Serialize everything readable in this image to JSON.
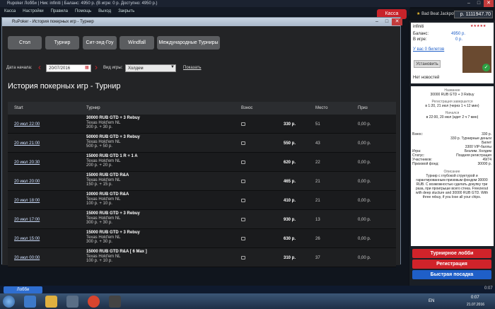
{
  "lobby": {
    "title": "Rupoker Лобби | Ник: infiniti | Баланс: 4950 р. (В игре: 0 р. Доступно: 4950 р.)",
    "menu": [
      "Касса",
      "Настройки",
      "Правила",
      "Помощь",
      "Выход",
      "Закрыть"
    ],
    "kassa_label": "Касса",
    "lobby_button": "Лобби"
  },
  "history": {
    "window_title": "RuPoker - История покерных игр - Турнир",
    "tabs": [
      "Стол",
      "Турнир",
      "Сит-энд-Гоу",
      "Windfall",
      "Международные Турниры"
    ],
    "date_label": "Дата начала:",
    "date_value": "20/07/2016",
    "game_label": "Вид игры:",
    "game_value": "Холдем",
    "show_label": "Показать",
    "page_title": "История покерных игр - Турнир",
    "columns": [
      "Start",
      "Турнир",
      "Взнос",
      "Место",
      "Приз"
    ],
    "rows": [
      {
        "date": "20 июл 22:00",
        "name": "30000 RUB GTD + 3 Rebuy",
        "game": "Texas Hold'em NL",
        "fee": "300 р. + 30 р.",
        "buyin": "330 р.",
        "place": "51",
        "prize": "0,00 р."
      },
      {
        "date": "20 июл 21:00",
        "name": "50000 RUB GTD + 3 Rebuy",
        "game": "Texas Hold'em NL",
        "fee": "500 р. + 50 р.",
        "buyin": "550 р.",
        "place": "43",
        "prize": "0,00 р."
      },
      {
        "date": "20 июл 20:30",
        "name": "15000 RUB GTD 1 R + 1 A",
        "game": "Texas Hold'em NL",
        "fee": "200 р. + 20 р.",
        "buyin": "620 р.",
        "place": "22",
        "prize": "0,00 р."
      },
      {
        "date": "20 июл 20:00",
        "name": "15000 RUB GTD R&A",
        "game": "Texas Hold'em NL",
        "fee": "150 р. + 15 р.",
        "buyin": "465 р.",
        "place": "21",
        "prize": "0,00 р."
      },
      {
        "date": "20 июл 18:00",
        "name": "10000 RUB GTD R&A",
        "game": "Texas Hold'em NL",
        "fee": "100 р. + 10 р.",
        "buyin": "410 р.",
        "place": "21",
        "prize": "0,00 р."
      },
      {
        "date": "20 июл 17:00",
        "name": "15000 RUB GTD + 3 Rebuy",
        "game": "Texas Hold'em NL",
        "fee": "300 р. + 30 р.",
        "buyin": "930 р.",
        "place": "13",
        "prize": "0,00 р."
      },
      {
        "date": "20 июл 15:00",
        "name": "15000 RUB GTD + 3 Rebuy",
        "game": "Texas Hold'em NL",
        "fee": "300 р. + 30 р.",
        "buyin": "630 р.",
        "place": "26",
        "prize": "0,00 р."
      },
      {
        "date": "20 июл 00:00",
        "name": "15000 RUB GTD R&A [ 6 Max ]",
        "game": "Texas Hold'em NL",
        "fee": "100 р. + 10 р.",
        "buyin": "310 р.",
        "place": "37",
        "prize": "0,00 р."
      }
    ]
  },
  "right": {
    "jackpot_label": "Bad Beat Jackpot",
    "jackpot_value": "р. 1111947.70",
    "nick": "infiniti",
    "stars": "★★★★★",
    "balance_label": "Баланс:",
    "balance_value": "4950 р.",
    "ingame_label": "В игре:",
    "ingame_value": "0 р.",
    "tickets": "У вас 0 билетов",
    "install": "Установить",
    "news": "Нет новостей",
    "tour_name_label": "Название",
    "tour_name": "30000 RUB GTD + 3 Rebuy",
    "reg_label": "Регистрация завершится",
    "reg_value": "в 1:20, 21 июл (через 1 ч 12 мин)",
    "start_label": "Начался",
    "start_value": "в 22:00, 20 июл (идет 2 ч 7 мин)",
    "buyin_label": "Взнос:",
    "buyin_value": "330 р.",
    "buyin_alt": "330 р. Турнирные деньги",
    "buyin_ticket": "Билет",
    "buyin_vip": "3300 VIP-баллы",
    "game_label": "Игра:",
    "game_value": "Безлим. Холдем",
    "status_label": "Статус:",
    "status_value": "Поздняя регистрация",
    "players_label": "Участников:",
    "players_value": "49/74",
    "prize_label": "Призовой фонд:",
    "prize_value": "30000 р.",
    "desc_label": "Описание",
    "desc_text": "Турнир с глубокой структурой и гарантированным призовым фондом 30000 RUB. С возможностью сделать докупку три раза, при проигрыше всего стека. Freezeout with deep stucture and 30000 RUB GTD. With three rebuy, if you lose all your chips.",
    "btn_lobby": "Турнирное лобби",
    "btn_reg": "Регистрация",
    "btn_fast": "Быстрая посадка",
    "colors": {
      "red": "#d0232a",
      "blue": "#1f5fc8"
    }
  },
  "taskbar": {
    "lang": "EN",
    "time": "0:07",
    "date": "21.07.2016",
    "time2": "0:07"
  }
}
